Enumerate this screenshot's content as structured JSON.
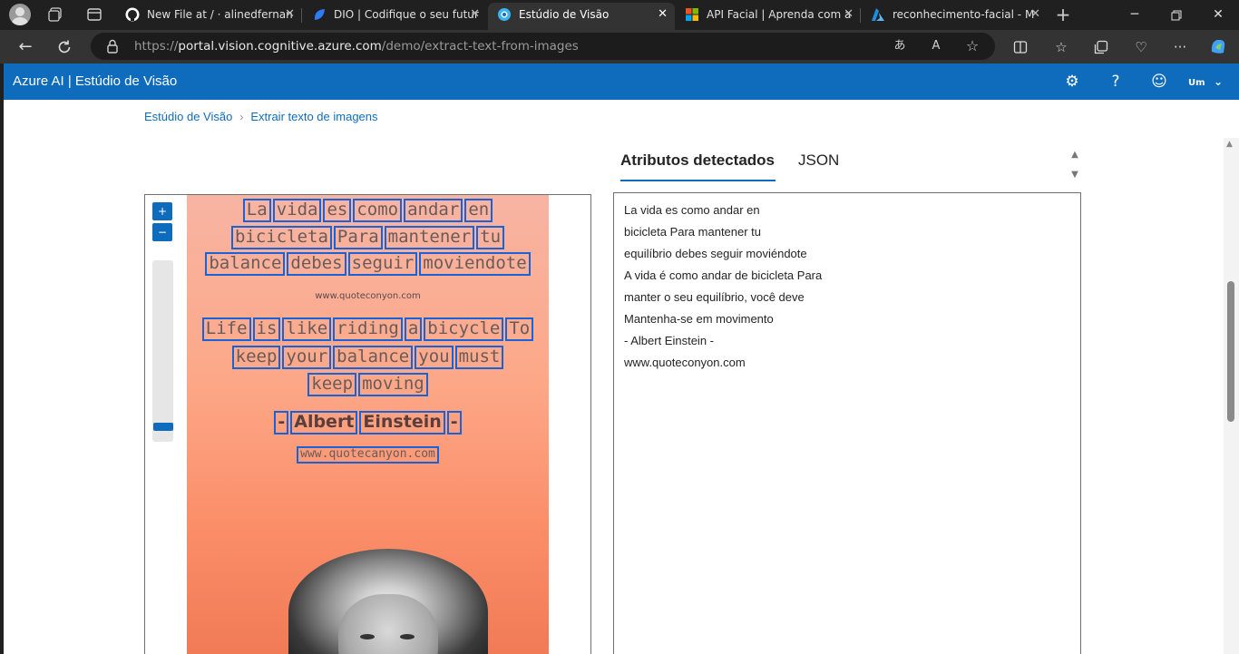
{
  "browser": {
    "tabs": [
      {
        "title": "New File at / · alinedfernan",
        "favicon": "github-icon",
        "active": false
      },
      {
        "title": "DIO | Codifique o seu futur",
        "favicon": "dio-icon",
        "active": false
      },
      {
        "title": "Estúdio de Visão",
        "favicon": "vision-studio-icon",
        "active": true
      },
      {
        "title": "API Facial | Aprenda com a",
        "favicon": "microsoft-icon",
        "active": false
      },
      {
        "title": "reconhecimento-facial - M",
        "favicon": "azure-icon",
        "active": false
      }
    ],
    "new_tab": "+",
    "url_prefix": "https://",
    "url_host": "portal.vision.cognitive.azure.com",
    "url_path": "/demo/extract-text-from-images"
  },
  "app": {
    "title": "Azure AI | Estúdio de Visão",
    "user_initials": "Um"
  },
  "breadcrumb": {
    "root": "Estúdio de Visão",
    "current": "Extrair texto de imagens"
  },
  "result_tabs": [
    {
      "label": "Atributos detectados",
      "selected": true
    },
    {
      "label": "JSON",
      "selected": false
    }
  ],
  "image": {
    "zoom_in": "+",
    "zoom_out": "−",
    "quote_lines": [
      [
        "La",
        "vida",
        "es",
        "como",
        "andar",
        "en"
      ],
      [
        "bicicleta",
        "Para",
        "mantener",
        "tu"
      ],
      [
        "balance",
        "debes",
        "seguir",
        "moviendote"
      ],
      [
        "Life",
        "is",
        "like",
        "riding",
        "a",
        "bicycle",
        "To"
      ],
      [
        "keep",
        "your",
        "balance",
        "you",
        "must"
      ],
      [
        "keep",
        "moving"
      ],
      [
        "-",
        "Albert",
        "Einstein",
        "-"
      ],
      [
        "www.quotecanyon.com"
      ]
    ],
    "small_site": "www.quoteconyon.com"
  },
  "detected_text": [
    "La vida es como andar en",
    "bicicleta Para mantener tu",
    "equilíbrio debes seguir moviéndote",
    "A vida é como andar de bicicleta Para",
    "manter o seu equilíbrio,  você deve",
    "Mantenha-se em movimento",
    "- Albert Einstein -",
    "www.quoteconyon.com"
  ],
  "colors": {
    "accent": "#0f6cbd",
    "ocr_box": "#1a63d6",
    "browser_chrome": "#202020"
  }
}
